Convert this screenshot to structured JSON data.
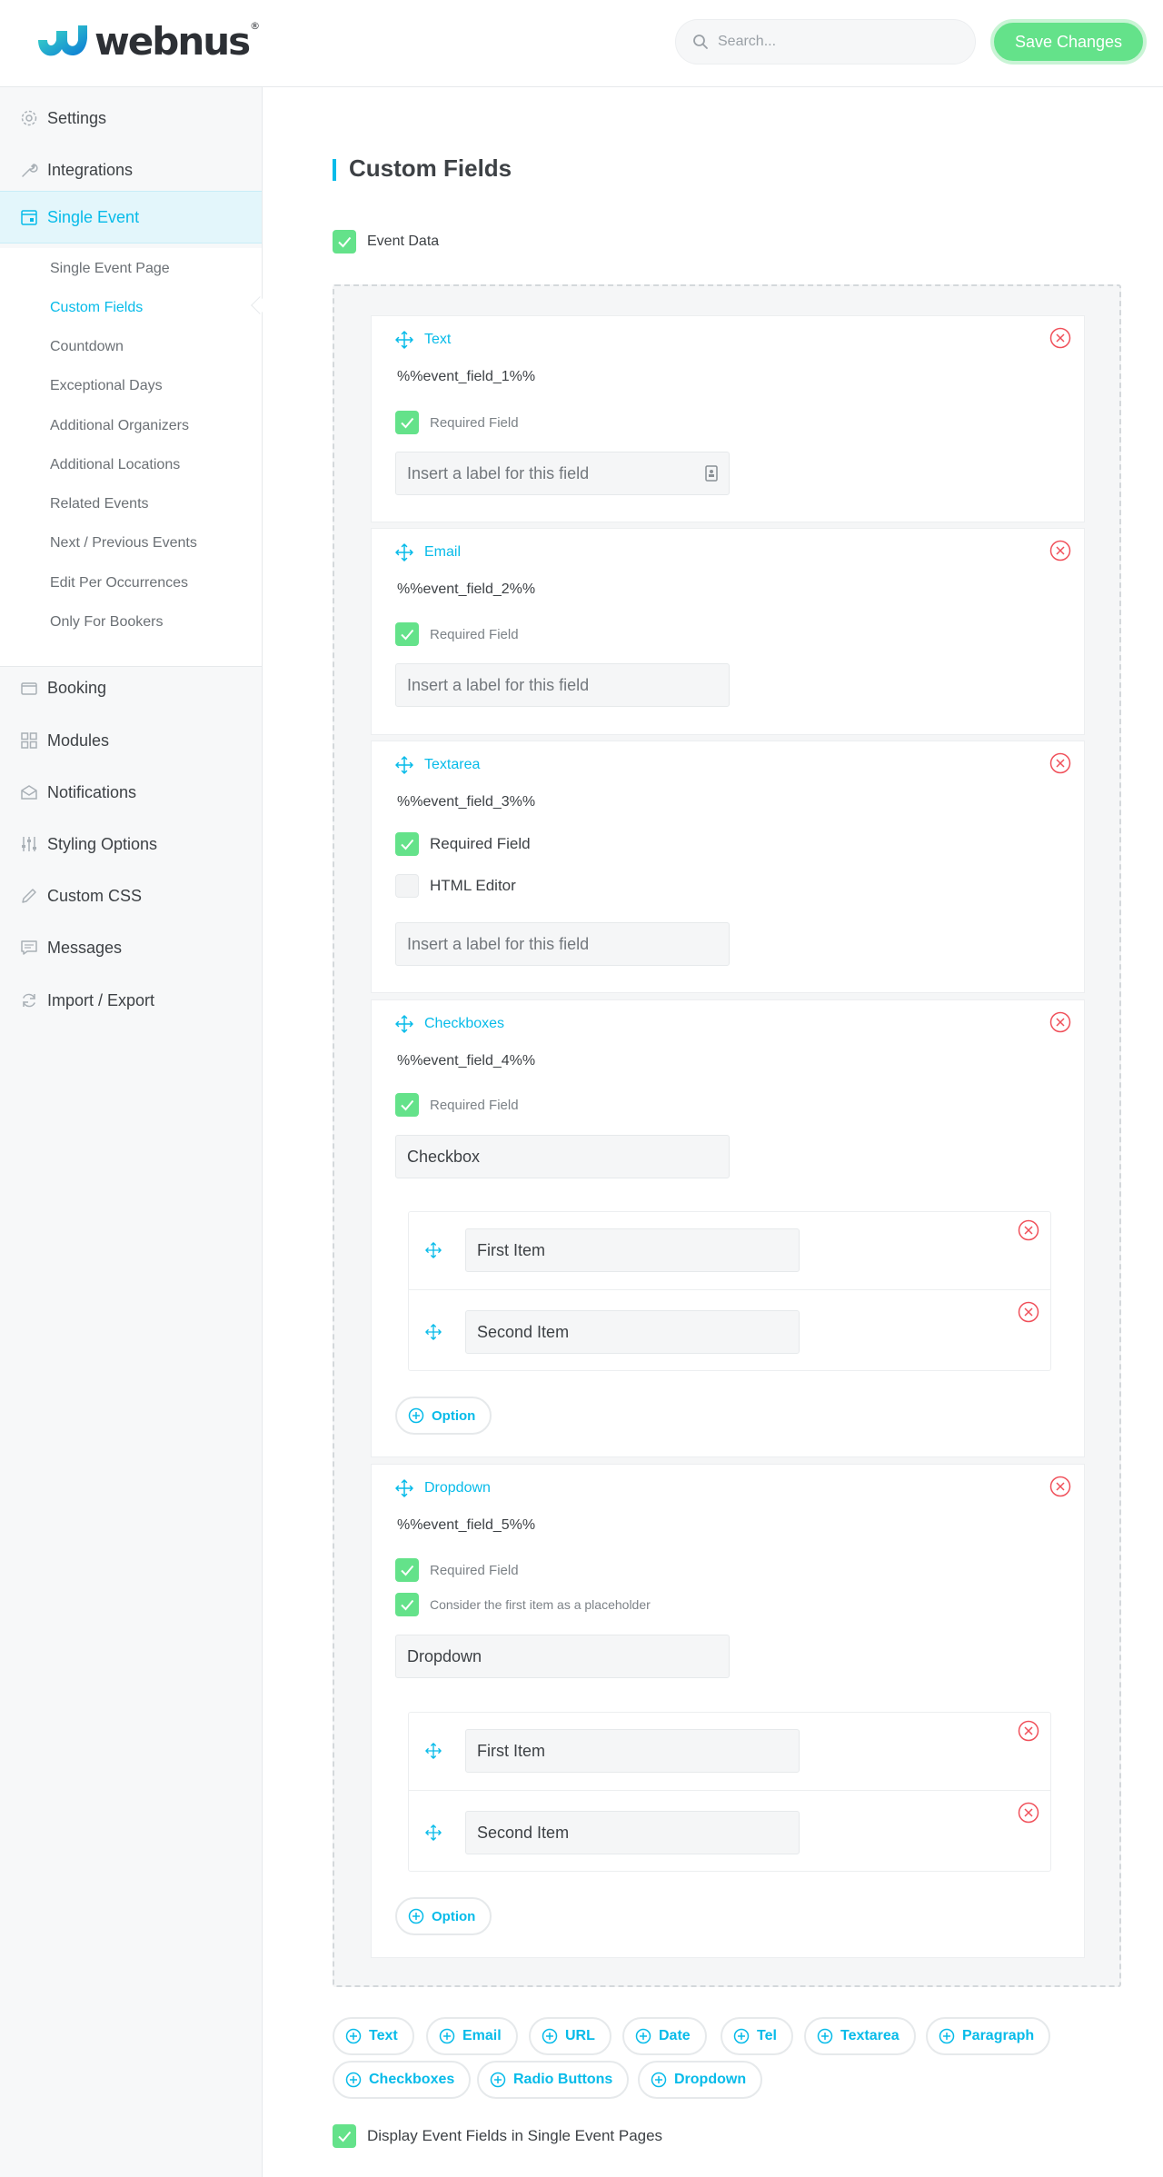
{
  "header": {
    "logo_text": "webnus",
    "logo_reg": "®",
    "search_placeholder": "Search...",
    "save_label": "Save Changes"
  },
  "sidebar": {
    "items": [
      {
        "label": "Settings",
        "icon": "gear-icon"
      },
      {
        "label": "Integrations",
        "icon": "wrench-icon"
      },
      {
        "label": "Single Event",
        "icon": "calendar-icon",
        "active": true
      },
      {
        "label": "Booking",
        "icon": "wallet-icon"
      },
      {
        "label": "Modules",
        "icon": "grid-icon"
      },
      {
        "label": "Notifications",
        "icon": "envelope-icon"
      },
      {
        "label": "Styling Options",
        "icon": "sliders-icon"
      },
      {
        "label": "Custom CSS",
        "icon": "pencil-icon"
      },
      {
        "label": "Messages",
        "icon": "chat-icon"
      },
      {
        "label": "Import / Export",
        "icon": "sync-icon"
      }
    ],
    "subitems": [
      "Single Event Page",
      "Custom Fields",
      "Countdown",
      "Exceptional Days",
      "Additional Organizers",
      "Additional Locations",
      "Related Events",
      "Next / Previous Events",
      "Edit Per Occurrences",
      "Only For Bookers"
    ],
    "active_subitem": "Custom Fields"
  },
  "main": {
    "title": "Custom Fields",
    "event_data_label": "Event Data",
    "event_data_checked": true,
    "fields": [
      {
        "type": "Text",
        "placeholder": "%%event_field_1%%",
        "required_label": "Required Field",
        "required": true,
        "input_placeholder": "Insert a label for this field"
      },
      {
        "type": "Email",
        "placeholder": "%%event_field_2%%",
        "required_label": "Required Field",
        "required": true,
        "input_placeholder": "Insert a label for this field"
      },
      {
        "type": "Textarea",
        "placeholder": "%%event_field_3%%",
        "required_label": "Required Field",
        "required": true,
        "html_editor_label": "HTML Editor",
        "html_editor": false,
        "input_placeholder": "Insert a label for this field"
      },
      {
        "type": "Checkboxes",
        "placeholder": "%%event_field_4%%",
        "required_label": "Required Field",
        "required": true,
        "input_value": "Checkbox",
        "options": [
          "First Item",
          "Second Item"
        ],
        "option_button": "Option"
      },
      {
        "type": "Dropdown",
        "placeholder": "%%event_field_5%%",
        "required_label": "Required Field",
        "required": true,
        "first_placeholder_label": "Consider the first item as a placeholder",
        "first_placeholder": true,
        "input_value": "Dropdown",
        "options": [
          "First Item",
          "Second Item"
        ],
        "option_button": "Option"
      }
    ],
    "add_buttons": [
      "Text",
      "Email",
      "URL",
      "Date",
      "Tel",
      "Textarea",
      "Paragraph",
      "Checkboxes",
      "Radio Buttons",
      "Dropdown"
    ],
    "display_label": "Display Event Fields in Single Event Pages",
    "display_checked": true
  },
  "colors": {
    "accent": "#07bbe9",
    "green": "#64e28a",
    "danger": "#f0505a"
  }
}
